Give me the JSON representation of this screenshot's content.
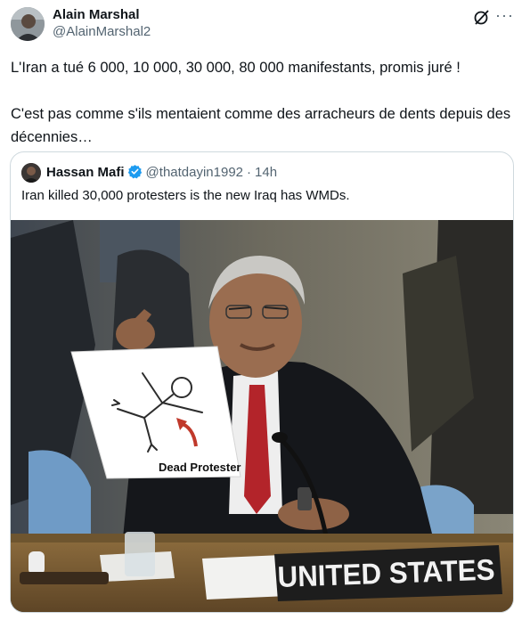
{
  "author": {
    "name": "Alain Marshal",
    "handle": "@AlainMarshal2"
  },
  "tweet_text": "L'Iran a tué 6 000, 10 000, 30 000, 80 000 manifestants, promis juré !\n\nC'est pas comme s'ils mentaient comme des arracheurs de dents depuis des décennies…",
  "quoted": {
    "name": "Hassan Mafi",
    "handle": "@thatdayin1992",
    "separator": "·",
    "time": "14h",
    "text": "Iran killed 30,000 protesters is the new Iraq has WMDs.",
    "photo": {
      "sign_text": "Dead Protester",
      "nameplate_text": "UNITED STATES"
    }
  },
  "icons": [
    "grok-icon",
    "more-icon",
    "verified-badge-icon"
  ],
  "colors": {
    "secondary_text": "#536471",
    "verified_blue": "#1d9bf0",
    "border": "#cfd9de"
  }
}
